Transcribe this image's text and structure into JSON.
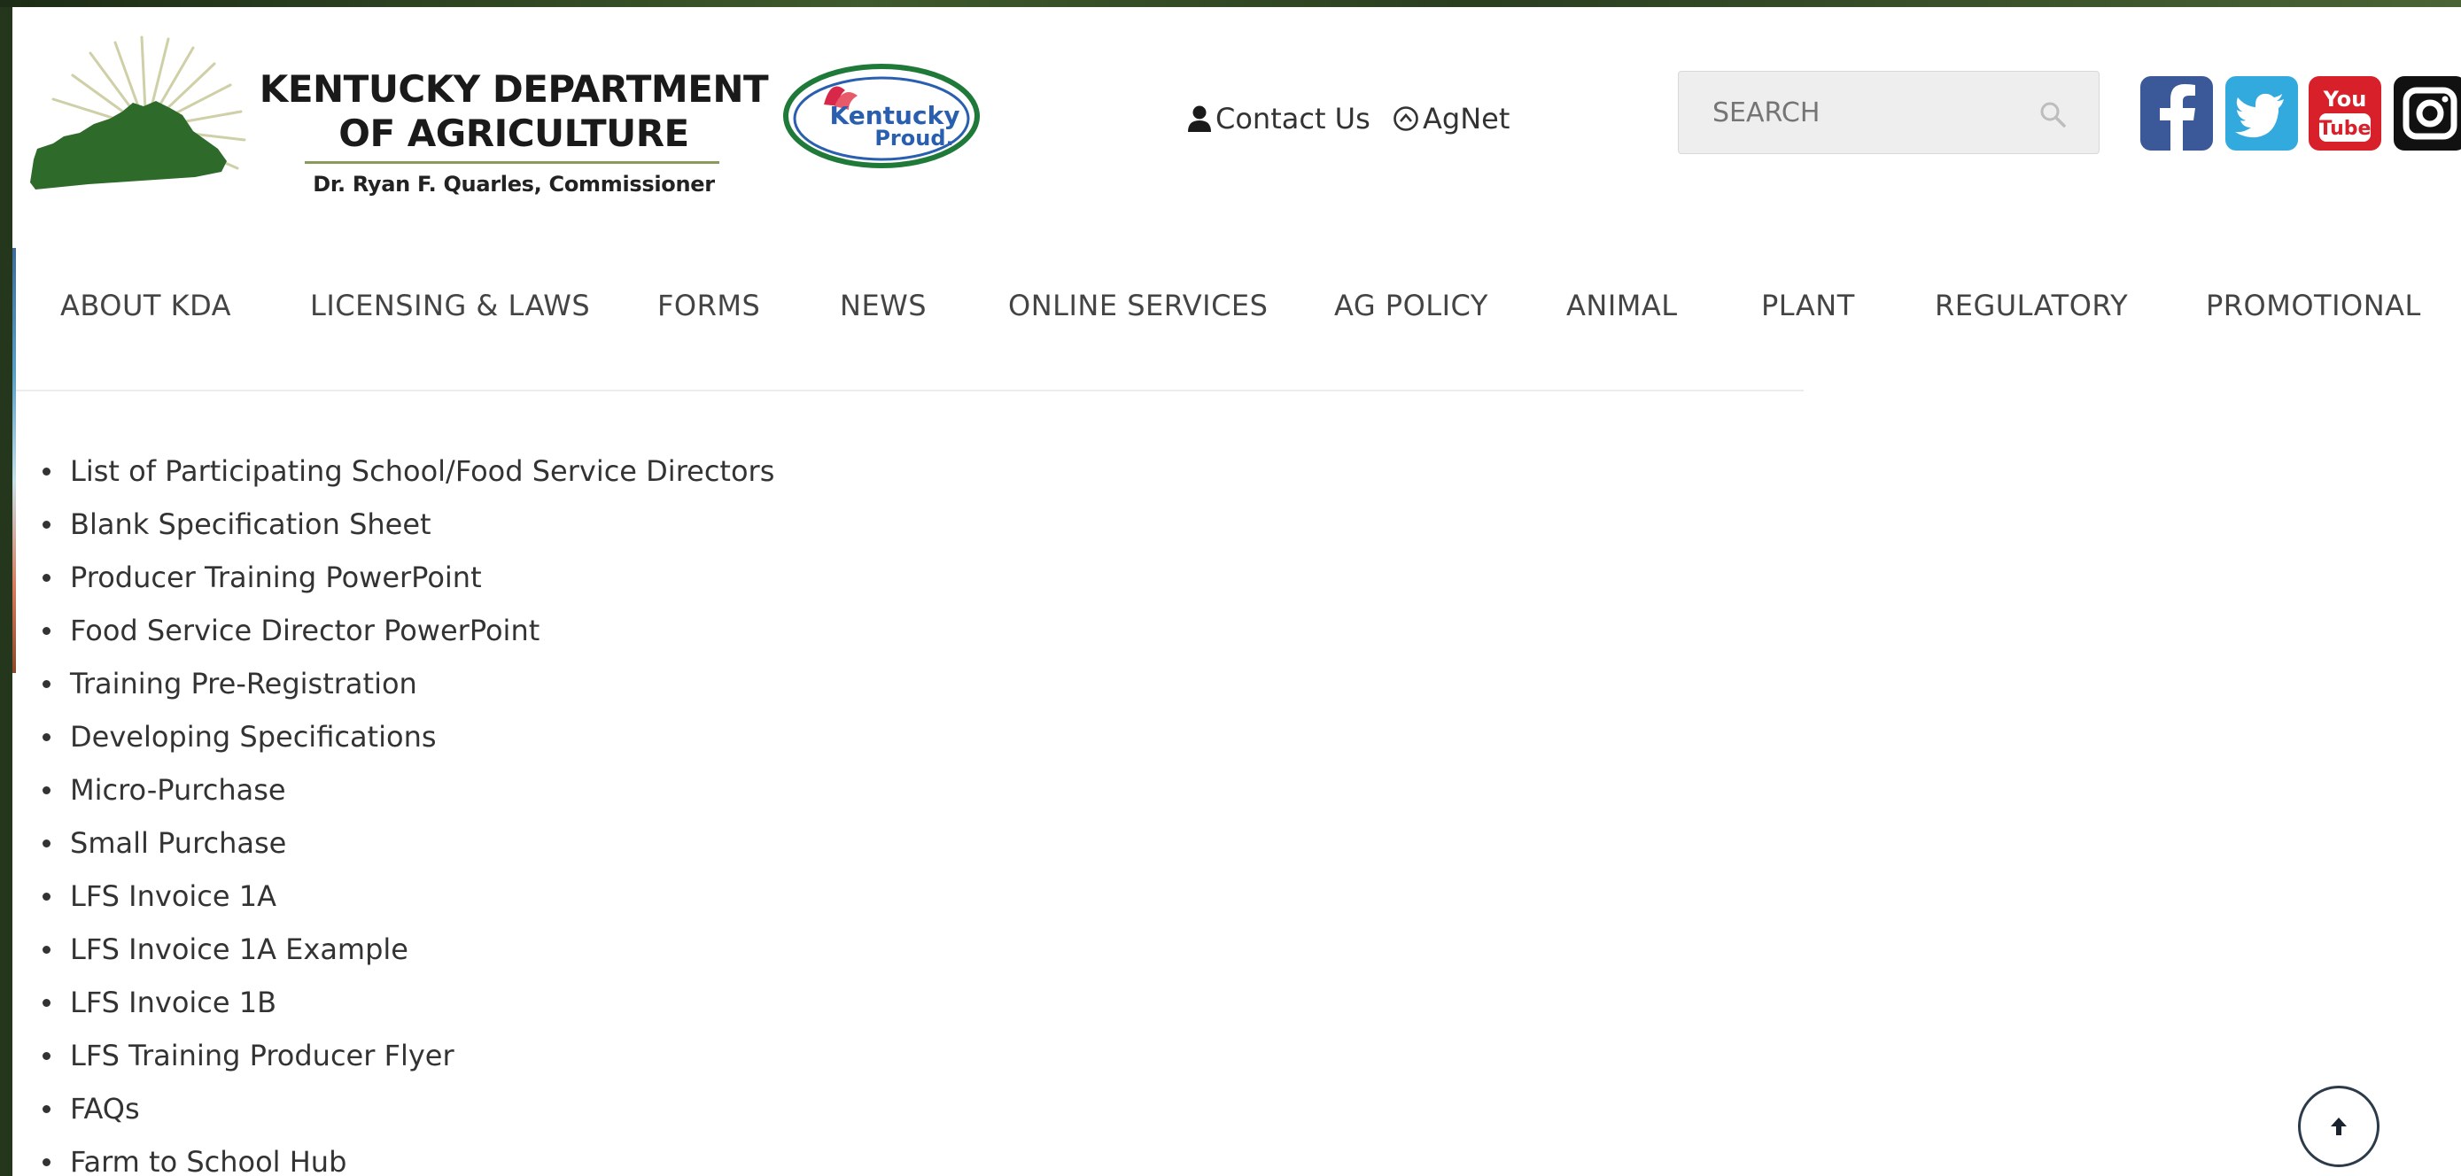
{
  "header": {
    "logo_title_line1": "KENTUCKY DEPARTMENT",
    "logo_title_line2": "OF AGRICULTURE",
    "logo_subtitle": "Dr. Ryan F. Quarles, Commissioner",
    "badge_line1": "Kentucky",
    "badge_line2": "Proud.",
    "contact_label": "Contact Us",
    "agnet_label": "AgNet",
    "search_placeholder": "SEARCH",
    "youtube_line1": "You",
    "youtube_line2": "Tube"
  },
  "nav": {
    "items": [
      "ABOUT KDA",
      "LICENSING & LAWS",
      "FORMS",
      "NEWS",
      "ONLINE SERVICES",
      "AG POLICY",
      "ANIMAL",
      "PLANT",
      "REGULATORY",
      "PROMOTIONAL"
    ]
  },
  "links": [
    "List of Participating School/Food Service Directors",
    "Blank Specification Sheet",
    "Producer Training PowerPoint",
    "Food Service Director PowerPoint",
    "Training Pre-Registration",
    "Developing Specifications",
    "Micro-Purchase",
    "Small Purchase",
    "LFS Invoice 1A",
    "LFS Invoice 1A Example",
    "LFS Invoice 1B",
    "LFS Training Producer Flyer",
    "FAQs",
    "Farm to School Hub"
  ],
  "colors": {
    "facebook": "#3b5998",
    "twitter": "#33aadd",
    "youtube": "#d8202a",
    "instagram": "#111111",
    "kentucky_green": "#2e6b2a"
  },
  "icons": {
    "contact": "person-icon",
    "agnet": "circle-chevron-up-icon",
    "search": "magnifier-icon",
    "back_to_top": "arrow-up-icon"
  }
}
